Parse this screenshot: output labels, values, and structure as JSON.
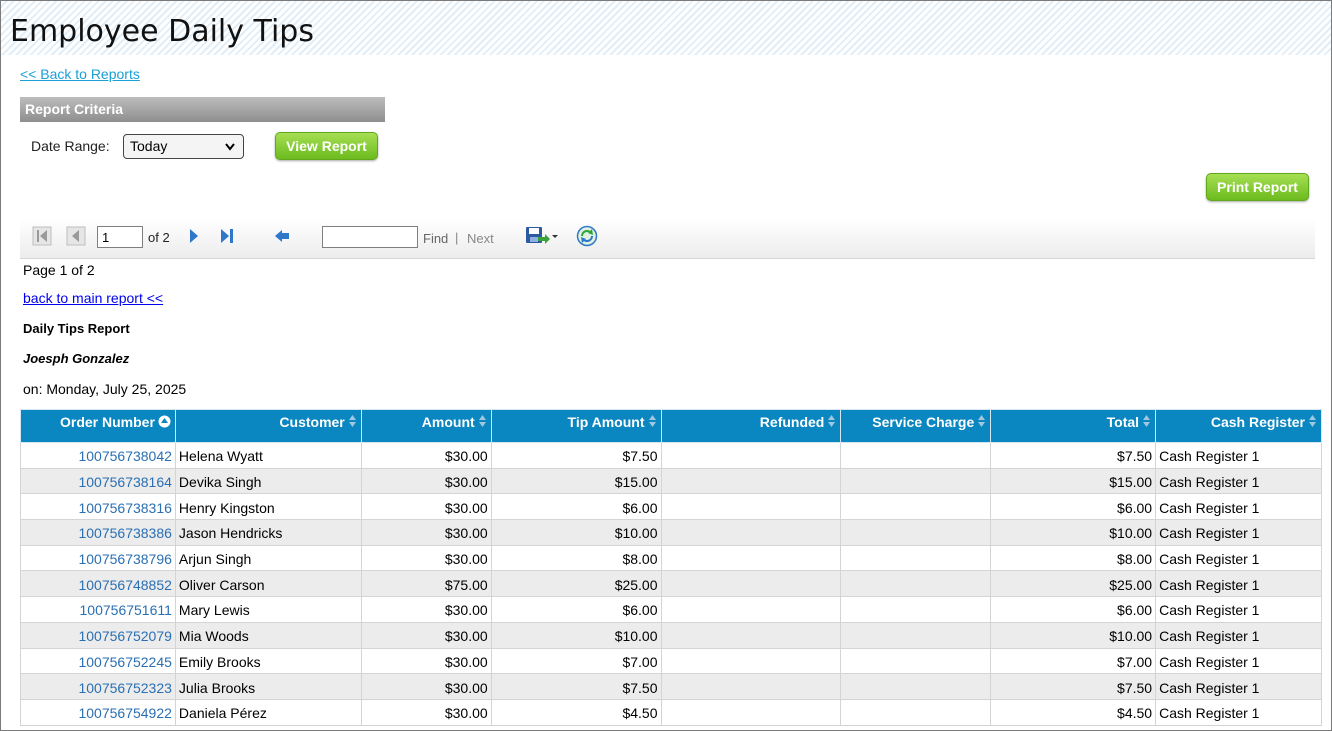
{
  "page_title": "Employee Daily Tips",
  "back_to_reports": "<< Back to Reports",
  "criteria": {
    "header": "Report Criteria",
    "date_range_label": "Date Range:",
    "date_range_value": "Today",
    "view_button": "View Report"
  },
  "print_button": "Print Report",
  "toolbar": {
    "current_page": "1",
    "of_pages": "of 2",
    "find_value": "",
    "find_label": "Find",
    "separator": "|",
    "next_label": "Next"
  },
  "report": {
    "page_info": "Page 1 of 2",
    "back_to_main": "back to main report <<",
    "title": "Daily Tips Report",
    "employee": "Joesph Gonzalez",
    "date_line": "on: Monday, July 25, 2025"
  },
  "table": {
    "columns": [
      "Order Number",
      "Customer",
      "Amount",
      "Tip Amount",
      "Refunded",
      "Service Charge",
      "Total",
      "Cash Register"
    ],
    "rows": [
      [
        "100756738042",
        "Helena Wyatt",
        "$30.00",
        "$7.50",
        "",
        "",
        "$7.50",
        "Cash Register 1"
      ],
      [
        "100756738164",
        "Devika Singh",
        "$30.00",
        "$15.00",
        "",
        "",
        "$15.00",
        "Cash Register 1"
      ],
      [
        "100756738316",
        "Henry Kingston",
        "$30.00",
        "$6.00",
        "",
        "",
        "$6.00",
        "Cash Register 1"
      ],
      [
        "100756738386",
        "Jason Hendricks",
        "$30.00",
        "$10.00",
        "",
        "",
        "$10.00",
        "Cash Register 1"
      ],
      [
        "100756738796",
        "Arjun Singh",
        "$30.00",
        "$8.00",
        "",
        "",
        "$8.00",
        "Cash Register 1"
      ],
      [
        "100756748852",
        "Oliver Carson",
        "$75.00",
        "$25.00",
        "",
        "",
        "$25.00",
        "Cash Register 1"
      ],
      [
        "100756751611",
        "Mary Lewis",
        "$30.00",
        "$6.00",
        "",
        "",
        "$6.00",
        "Cash Register 1"
      ],
      [
        "100756752079",
        "Mia Woods",
        "$30.00",
        "$10.00",
        "",
        "",
        "$10.00",
        "Cash Register 1"
      ],
      [
        "100756752245",
        "Emily Brooks",
        "$30.00",
        "$7.00",
        "",
        "",
        "$7.00",
        "Cash Register 1"
      ],
      [
        "100756752323",
        "Julia Brooks",
        "$30.00",
        "$7.50",
        "",
        "",
        "$7.50",
        "Cash Register 1"
      ],
      [
        "100756754922",
        "Daniela Pérez",
        "$30.00",
        "$4.50",
        "",
        "",
        "$4.50",
        "Cash Register 1"
      ]
    ]
  },
  "colors": {
    "header_blue": "#0a86c1",
    "link_blue": "#1a9fd6",
    "order_link": "#2a6fb3",
    "button_green": "#7cc52a"
  },
  "icons": [
    "first-page-icon",
    "previous-page-icon",
    "next-page-icon",
    "last-page-icon",
    "back-arrow-icon",
    "save-export-icon",
    "refresh-icon",
    "sort-icon",
    "chevron-down-icon"
  ]
}
